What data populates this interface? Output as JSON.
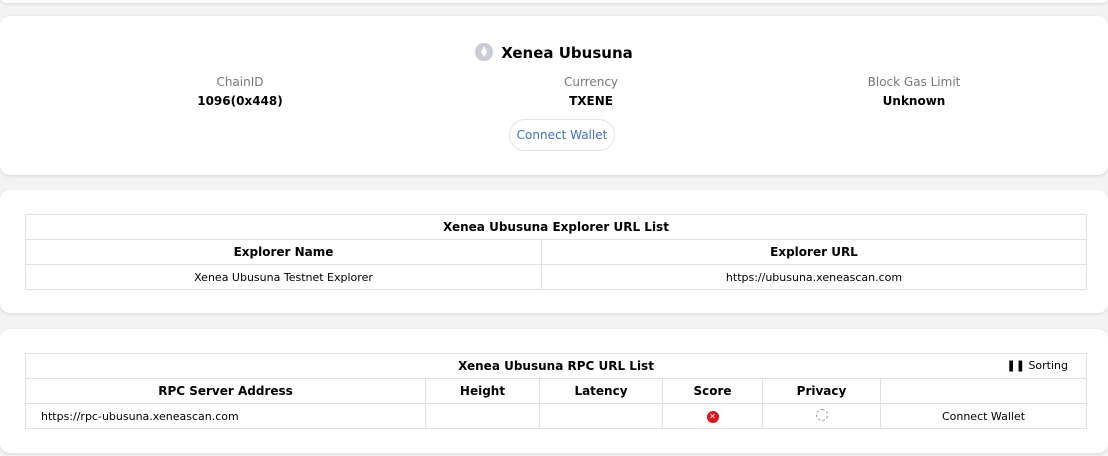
{
  "chain": {
    "name": "Xenea Ubusuna",
    "chainid_label": "ChainID",
    "chainid": "1096(0x448)",
    "currency_label": "Currency",
    "currency": "TXENE",
    "gas_label": "Block Gas Limit",
    "gas": "Unknown",
    "connect": "Connect Wallet"
  },
  "explorer": {
    "title": "Xenea Ubusuna Explorer URL List",
    "headers": [
      "Explorer Name",
      "Explorer URL"
    ],
    "rows": [
      {
        "name": "Xenea Ubusuna Testnet Explorer",
        "url": "https://ubusuna.xeneascan.com"
      }
    ]
  },
  "rpc": {
    "title": "Xenea Ubusuna RPC URL List",
    "sorting": "Sorting",
    "headers": [
      "RPC Server Address",
      "Height",
      "Latency",
      "Score",
      "Privacy",
      ""
    ],
    "rows": [
      {
        "address": "https://rpc-ubusuna.xeneascan.com",
        "height": "",
        "latency": "",
        "score_icon": "error-icon",
        "privacy_icon": "unknown-icon",
        "action": "Connect Wallet"
      }
    ]
  }
}
